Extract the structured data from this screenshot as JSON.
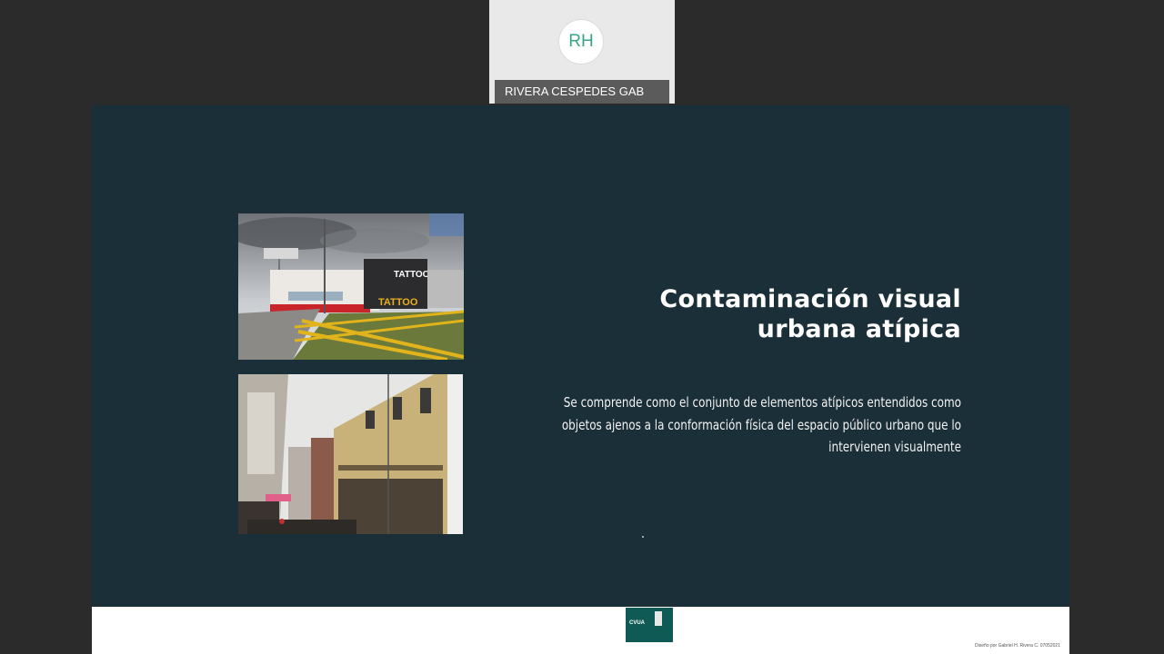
{
  "participant": {
    "initials": "RH",
    "name": "RIVERA CESPEDES GAB"
  },
  "slide": {
    "title_line1": "Contaminación visual",
    "title_line2": "urbana atípica",
    "body_line1": "Se comprende como el conjunto de elementos atípicos entendidos como",
    "body_line2": "objetos ajenos a la conformación física del espacio público urbano que lo",
    "body_line3": "intervienen visualmente",
    "photo1_sign1": "TATTOO",
    "photo1_sign2": "TATTOO"
  },
  "footer": {
    "logo_text": "CVUA",
    "credit": "Diseño por Gabriel H. Rivera C. 07052021"
  },
  "colors": {
    "slide_bg": "#1b2f38",
    "app_bg": "#2b2b2b",
    "avatar_text": "#3aa38a",
    "logo_bg": "#0f5a55"
  }
}
